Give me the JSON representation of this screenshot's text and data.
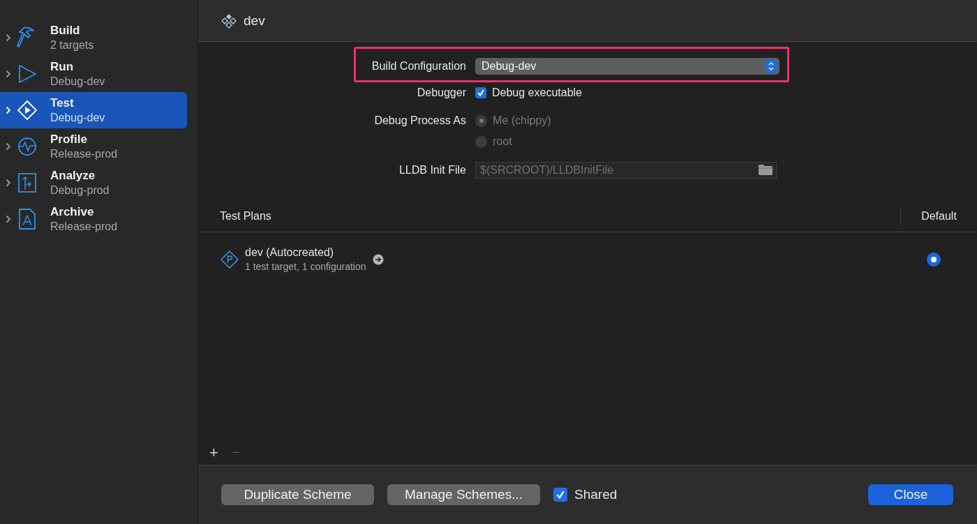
{
  "sidebar": {
    "items": [
      {
        "kind": "build",
        "title": "Build",
        "subtitle": "2 targets",
        "selected": false
      },
      {
        "kind": "run",
        "title": "Run",
        "subtitle": "Debug-dev",
        "selected": false
      },
      {
        "kind": "test",
        "title": "Test",
        "subtitle": "Debug-dev",
        "selected": true
      },
      {
        "kind": "profile",
        "title": "Profile",
        "subtitle": "Release-prod",
        "selected": false
      },
      {
        "kind": "analyze",
        "title": "Analyze",
        "subtitle": "Debug-prod",
        "selected": false
      },
      {
        "kind": "archive",
        "title": "Archive",
        "subtitle": "Release-prod",
        "selected": false
      }
    ]
  },
  "header": {
    "title": "dev"
  },
  "form": {
    "build_configuration": {
      "label": "Build Configuration",
      "value": "Debug-dev",
      "highlighted": true
    },
    "debugger": {
      "label": "Debugger",
      "option": "Debug executable",
      "checked": true
    },
    "debug_process_as": {
      "label": "Debug Process As",
      "options": [
        {
          "label": "Me (chippy)",
          "selected": true,
          "disabled": true
        },
        {
          "label": "root",
          "selected": false,
          "disabled": true
        }
      ]
    },
    "lldb_init_file": {
      "label": "LLDB Init File",
      "placeholder": "$(SRCROOT)/LLDBInitFile"
    }
  },
  "test_plans": {
    "columns": [
      "Test Plans",
      "Default"
    ],
    "rows": [
      {
        "name": "dev (Autocreated)",
        "detail": "1 test target, 1 configuration",
        "default": true
      }
    ],
    "add": "+",
    "remove": "−"
  },
  "footer": {
    "buttons": [
      "Duplicate Scheme",
      "Manage Schemes..."
    ],
    "shared": {
      "label": "Shared",
      "checked": true
    },
    "close": "Close"
  }
}
